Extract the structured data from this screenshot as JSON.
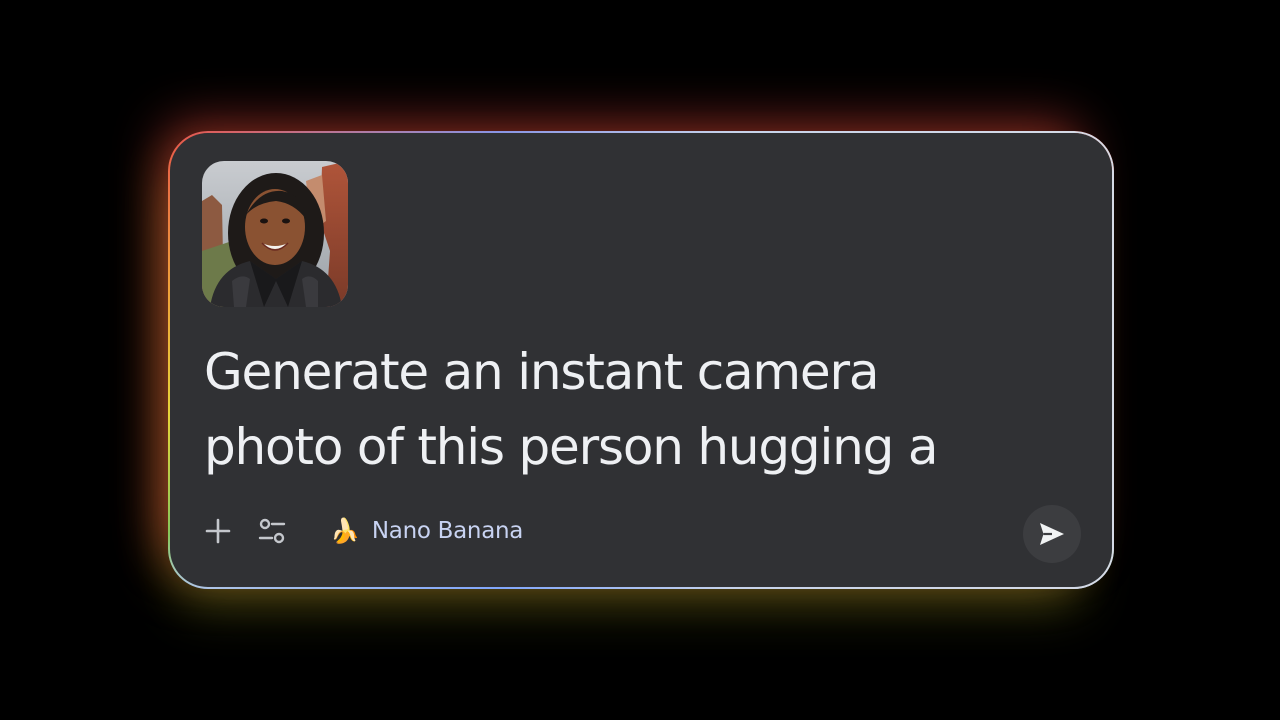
{
  "composer": {
    "attachment": {
      "alt": "Attached photo of a smiling woman"
    },
    "prompt_text": "Generate an instant camera\nphoto of this person hugging a",
    "toolbar": {
      "add_icon": "plus-icon",
      "tools_icon": "sliders-icon",
      "model_icon": "banana-emoji",
      "model_emoji": "🍌",
      "model_label": "Nano Banana"
    },
    "send_icon": "send-arrow-icon"
  },
  "colors": {
    "background": "#000000",
    "card": "#303134",
    "prompt_text": "#eef0f3",
    "model_label": "#c8d3f2",
    "send_button": "#3c3d40"
  }
}
